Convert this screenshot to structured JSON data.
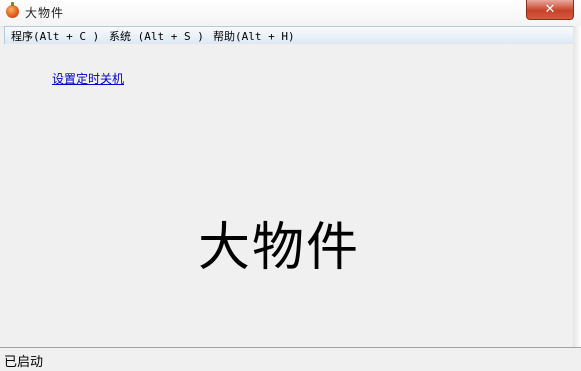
{
  "window": {
    "title": "大物件",
    "close_glyph": "✕"
  },
  "menu": {
    "items": [
      {
        "label": "程序(Alt + C )"
      },
      {
        "label": "系统 (Alt + S )"
      },
      {
        "label": "帮助(Alt + H)"
      }
    ]
  },
  "content": {
    "link_text": "设置定时关机",
    "big_title": "大物件"
  },
  "status": {
    "text": "已启动"
  },
  "colors": {
    "link": "#0000cc",
    "close_button": "#c7432a",
    "menubar": "#dde8f3"
  },
  "icons": {
    "app": "pumpkin-icon",
    "close": "close-icon"
  }
}
